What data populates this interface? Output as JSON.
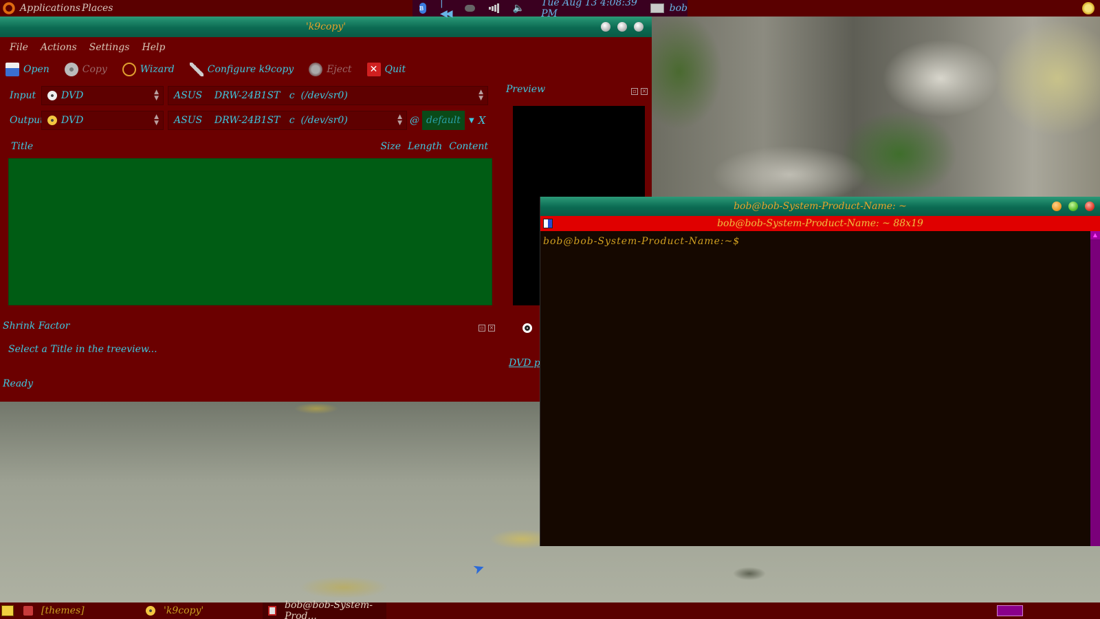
{
  "top_panel": {
    "applications": "Applications",
    "places": "Places",
    "clock": "Tue Aug 13   4:08:39 PM",
    "user": "bob"
  },
  "k9copy": {
    "title": "'k9copy'",
    "menu": [
      "File",
      "Actions",
      "Settings",
      "Help"
    ],
    "toolbar": {
      "open": "Open",
      "copy": "Copy",
      "wizard": "Wizard",
      "configure": "Configure k9copy",
      "eject": "Eject",
      "quit": "Quit"
    },
    "input": {
      "label": "Input",
      "source": "DVD",
      "device": "ASUS    DRW-24B1ST   c  (/dev/sr0)"
    },
    "output": {
      "label": "Output",
      "target": "DVD",
      "device": "ASUS    DRW-24B1ST   c  (/dev/sr0)",
      "at": "@",
      "speed": "default",
      "clear": "X"
    },
    "tree_columns": {
      "title": "Title",
      "size": "Size",
      "length": "Length",
      "content": "Content"
    },
    "shrink": {
      "title": "Shrink Factor",
      "message": "Select a Title in the treeview..."
    },
    "status": "Ready",
    "preview": {
      "title": "Preview",
      "dvd_label": "DVD p"
    }
  },
  "terminal": {
    "title": "bob@bob-System-Product-Name: ~",
    "tab_title": "bob@bob-System-Product-Name: ~ 88x19",
    "prompt": "bob@bob-System-Product-Name:~$"
  },
  "taskbar": {
    "items": [
      "[themes]",
      "'k9copy'",
      "bob@bob-System-Prod..."
    ]
  }
}
